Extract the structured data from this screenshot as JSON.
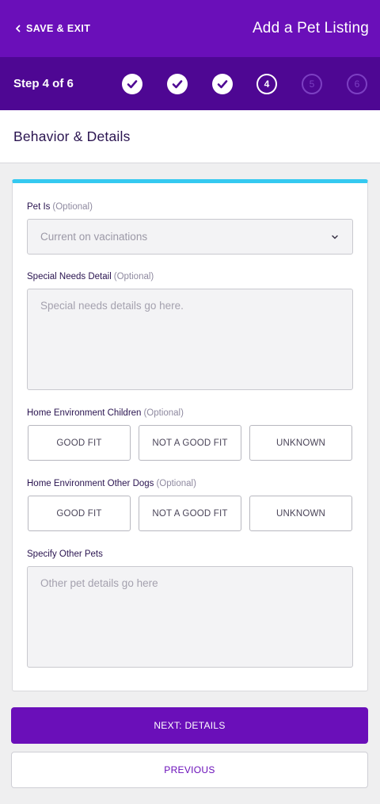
{
  "header": {
    "save_exit_label": "SAVE & EXIT",
    "title": "Add a Pet Listing"
  },
  "steps": {
    "label": "Step 4 of 6",
    "items": [
      {
        "number": "1",
        "status": "done"
      },
      {
        "number": "2",
        "status": "done"
      },
      {
        "number": "3",
        "status": "done"
      },
      {
        "number": "4",
        "status": "current"
      },
      {
        "number": "5",
        "status": "pending"
      },
      {
        "number": "6",
        "status": "pending"
      }
    ]
  },
  "section": {
    "title": "Behavior & Details"
  },
  "form": {
    "pet_is": {
      "label": "Pet Is",
      "optional": "(Optional)",
      "value": "Current on vacinations"
    },
    "special_needs": {
      "label": "Special Needs Detail",
      "optional": "(Optional)",
      "placeholder": "Special needs details go here."
    },
    "children": {
      "label": "Home Environment Children",
      "optional": "(Optional)",
      "options": [
        "GOOD FIT",
        "NOT A GOOD FIT",
        "UNKNOWN"
      ]
    },
    "other_dogs": {
      "label": "Home Environment Other Dogs",
      "optional": "(Optional)",
      "options": [
        "GOOD FIT",
        "NOT A GOOD FIT",
        "UNKNOWN"
      ]
    },
    "other_pets": {
      "label": "Specify Other Pets",
      "placeholder": "Other pet details go here"
    }
  },
  "actions": {
    "next_label": "NEXT: DETAILS",
    "previous_label": "PREVIOUS"
  },
  "colors": {
    "primary": "#6a0fb9",
    "step_bar": "#4e0793",
    "accent": "#35c9f0"
  }
}
